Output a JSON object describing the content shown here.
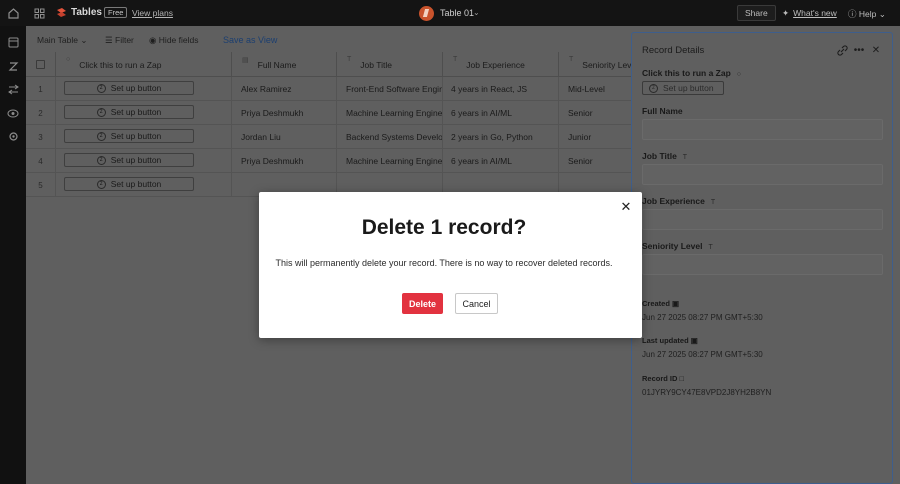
{
  "topbar": {
    "app_title": "Tables",
    "plan_badge": "Free",
    "view_plans": "View plans",
    "table_name": "Table 01",
    "share": "Share",
    "whats_new": "What's new",
    "help": "Help"
  },
  "toolbar": {
    "view_name": "Main Table",
    "filter": "Filter",
    "hide_fields": "Hide fields",
    "save_as_view": "Save as View"
  },
  "grid": {
    "columns": [
      "Click this to run a Zap",
      "Full Name",
      "Job Title",
      "Job Experience",
      "Seniority Level"
    ],
    "rows": [
      {
        "num": "1",
        "button": "Set up button",
        "name": "Alex Ramirez",
        "title": "Front-End Software Engineer",
        "experience": "4 years in React, JS",
        "level": "Mid-Level"
      },
      {
        "num": "2",
        "button": "Set up button",
        "name": "Priya Deshmukh",
        "title": "Machine Learning Engineer",
        "experience": "6 years in AI/ML",
        "level": "Senior"
      },
      {
        "num": "3",
        "button": "Set up button",
        "name": "Jordan Liu",
        "title": "Backend Systems Developer",
        "experience": "2 years in Go, Python",
        "level": "Junior"
      },
      {
        "num": "4",
        "button": "Set up button",
        "name": "Priya Deshmukh",
        "title": "Machine Learning Engineer",
        "experience": "6 years in AI/ML",
        "level": "Senior"
      },
      {
        "num": "5",
        "button": "Set up button",
        "name": "",
        "title": "",
        "experience": "",
        "level": ""
      }
    ]
  },
  "panel": {
    "title": "Record Details",
    "zap_label": "Click this to run a Zap",
    "setup_button": "Set up button",
    "fields": [
      "Full Name",
      "Job Title",
      "Job Experience",
      "Seniority Level"
    ],
    "created_label": "Created",
    "created_value": "Jun 27 2025 08:27 PM GMT+5:30",
    "updated_label": "Last updated",
    "updated_value": "Jun 27 2025 08:27 PM GMT+5:30",
    "record_id_label": "Record ID",
    "record_id_value": "01JYRY9CY47E8VPD2J8YH2B8YN"
  },
  "modal": {
    "title": "Delete 1 record?",
    "message": "This will permanently delete your record. There is no way to recover deleted records.",
    "delete": "Delete",
    "cancel": "Cancel"
  },
  "colors": {
    "delete_button": "#e2323f",
    "accent_blue": "#3e5e8c",
    "overlay": "#5f5f5f"
  }
}
